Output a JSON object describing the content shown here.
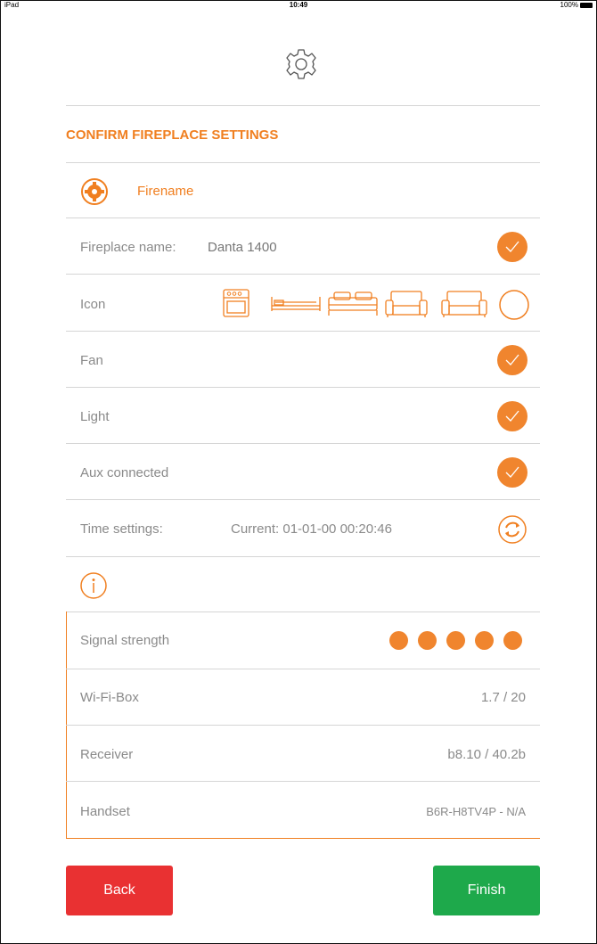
{
  "status_bar": {
    "device": "iPad",
    "time": "10:49",
    "battery": "100%"
  },
  "title": "CONFIRM FIREPLACE SETTINGS",
  "section": {
    "label": "Firename"
  },
  "rows": {
    "fireplace_name": {
      "label": "Fireplace name:",
      "value": "Danta 1400"
    },
    "icon": {
      "label": "Icon"
    },
    "fan": {
      "label": "Fan"
    },
    "light": {
      "label": "Light"
    },
    "aux": {
      "label": "Aux connected"
    },
    "time": {
      "label": "Time settings:",
      "value": "Current: 01-01-00 00:20:46"
    }
  },
  "info": {
    "signal": {
      "label": "Signal strength",
      "dots": 5
    },
    "wifi_box": {
      "label": "Wi-Fi-Box",
      "value": "1.7 / 20"
    },
    "receiver": {
      "label": "Receiver",
      "value": "b8.10 / 40.2b"
    },
    "handset": {
      "label": "Handset",
      "value": "B6R-H8TV4P - N/A"
    }
  },
  "buttons": {
    "back": "Back",
    "finish": "Finish"
  },
  "colors": {
    "accent": "#f07f20",
    "back": "#e93132",
    "finish": "#1ea94b"
  },
  "icons": [
    "settings-icon",
    "oven-icon",
    "bed-icon",
    "double-bed-icon",
    "armchair-icon",
    "sofa-icon",
    "refresh-icon",
    "info-icon",
    "check-icon"
  ]
}
